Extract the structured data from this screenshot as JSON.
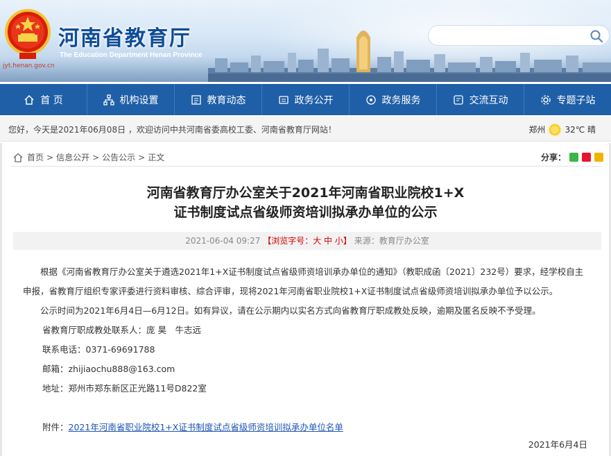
{
  "header": {
    "site_title": "河南省教育厅",
    "site_subtitle": "The Education Department Henan Province",
    "site_url": "jyt.henan.gov.cn",
    "search_placeholder": ""
  },
  "nav": {
    "items": [
      {
        "label": "首 页",
        "icon": "home-icon"
      },
      {
        "label": "机构设置",
        "icon": "org-chart-icon"
      },
      {
        "label": "教育动态",
        "icon": "news-icon"
      },
      {
        "label": "政务公开",
        "icon": "document-icon"
      },
      {
        "label": "政务服务",
        "icon": "service-icon"
      },
      {
        "label": "交流互动",
        "icon": "chat-icon"
      },
      {
        "label": "专题子站",
        "icon": "settings-icon"
      }
    ]
  },
  "greeting": {
    "text": "您好，今天是2021年06月08日 ，欢迎访问中共河南省委高校工委、河南省教育厅网站！",
    "city": "郑州",
    "temp": "32℃ 晴",
    "weather_icon": "sun-icon"
  },
  "breadcrumb": {
    "items": [
      "首页",
      "信息公开",
      "公告公示"
    ],
    "current": "正文",
    "separator": ">"
  },
  "share": {
    "label": "分享：",
    "icons": [
      "wechat-icon",
      "weibo-icon",
      "qq-icon"
    ]
  },
  "article": {
    "title_line1": "河南省教育厅办公室关于2021年河南省职业院校1+X",
    "title_line2": "证书制度试点省级师资培训拟承办单位的公示",
    "meta_date": "2021-06-04 09:27",
    "font_size_label": "【浏览字号：",
    "font_large": "大",
    "font_medium": "中",
    "font_small": "小",
    "font_size_end": "】",
    "source": "来源：教育厅办公室",
    "paragraph1": "根据《河南省教育厅办公室关于遴选2021年1+X证书制度试点省级师资培训承办单位的通知》（教职成函〔2021〕232号）要求，经学校自主申报，省教育厅组织专家评委进行资料审核、综合评审，现将2021年河南省职业院校1+X证书制度试点省级师资培训拟承办单位予以公示。",
    "paragraph2": "公示时间为2021年6月4日—6月12日。如有异议，请在公示期内以实名方式向省教育厅职成教处反映，逾期及匿名反映不予受理。",
    "contact_line": "省教育厅职成教处联系人：庞 昊　牛志远",
    "phone_line": "联系电话：0371-69691788",
    "email_line": "邮箱：zhijiaochu888@163.com",
    "address_line": "地址：郑州市郑东新区正光路11号D822室",
    "attachment_label": "附件：",
    "attachment_link": "2021年河南省职业院校1+X证书制度试点省级师资培训拟承办单位名单",
    "sign_date": "2021年6月4日"
  },
  "colors": {
    "nav_bg": "#1f5fa7",
    "title_blue": "#0e4c98",
    "link_blue": "#1e53b4",
    "accent_red": "#d40000"
  }
}
